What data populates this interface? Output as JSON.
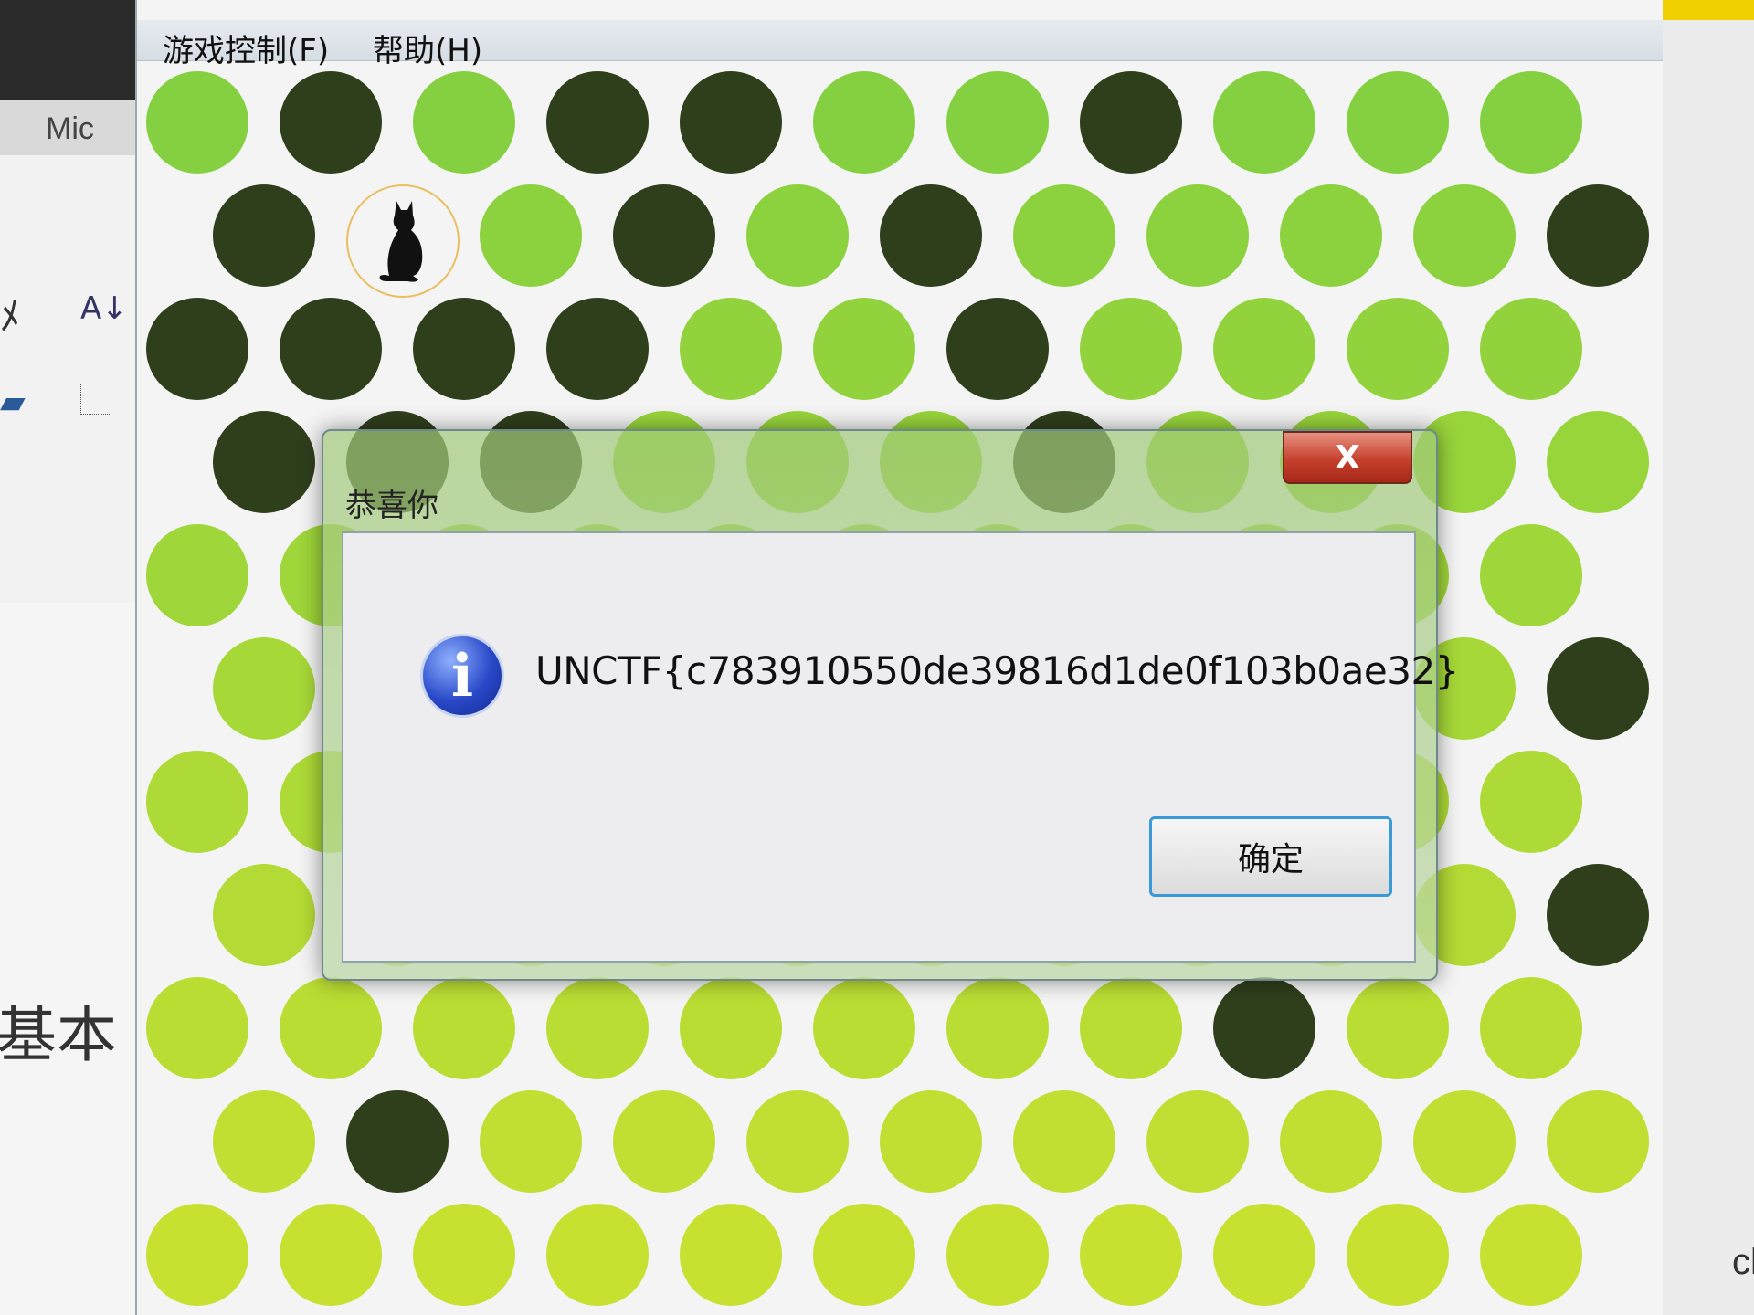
{
  "window": {
    "menu": [
      {
        "label": "游戏控制(F)"
      },
      {
        "label": "帮助(H)"
      }
    ]
  },
  "board": {
    "colors": {
      "occupied": "#2f3f1c",
      "free_top": "#84d040",
      "free_bottom": "#c8e030",
      "cat_border": "#e8c060"
    },
    "occupied_cells": [
      [
        0,
        1
      ],
      [
        0,
        3
      ],
      [
        0,
        4
      ],
      [
        0,
        7
      ],
      [
        1,
        0
      ],
      [
        1,
        3
      ],
      [
        1,
        5
      ],
      [
        1,
        10
      ],
      [
        2,
        0
      ],
      [
        2,
        1
      ],
      [
        2,
        2
      ],
      [
        2,
        3
      ],
      [
        2,
        6
      ],
      [
        3,
        0
      ],
      [
        3,
        1
      ],
      [
        3,
        2
      ],
      [
        3,
        6
      ],
      [
        5,
        10
      ],
      [
        7,
        10
      ],
      [
        8,
        8
      ],
      [
        9,
        1
      ]
    ],
    "cat_cell": [
      1,
      1
    ],
    "rows": 11,
    "cols": 11
  },
  "dialog": {
    "title": "恭喜你",
    "close_label": "X",
    "message": "UNCTF{c783910550de39816d1de0f103b0ae32}",
    "ok_label": "确定",
    "icon": "info-icon"
  },
  "background": {
    "left_text_top": "Mic",
    "left_text_bottom": "基本",
    "right_text": "cl"
  }
}
